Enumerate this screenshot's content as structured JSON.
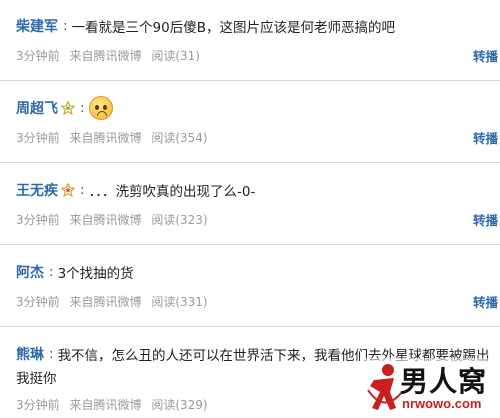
{
  "posts": [
    {
      "author": "柴建军",
      "content": "一看就是三个90后傻B，这图片应该是何老师恶搞的吧",
      "time": "3分钟前",
      "source": "来自腾讯微博",
      "reads": "阅读(31)",
      "forward": "转播"
    },
    {
      "author": "周超飞",
      "content": "",
      "time": "3分钟前",
      "source": "来自腾讯微博",
      "reads": "阅读(354)",
      "forward": "转播",
      "icon": "star-icon",
      "emoji": "crying-face-emoji"
    },
    {
      "author": "王无疾",
      "content": "．．．洗剪吹真的出现了么-0-",
      "time": "3分钟前",
      "source": "来自腾讯微博",
      "reads": "阅读(323)",
      "forward": "转播",
      "icon": "star-icon"
    },
    {
      "author": "阿杰",
      "content": "3个找抽的货",
      "time": "3分钟前",
      "source": "来自腾讯微博",
      "reads": "阅读(331)",
      "forward": "转播"
    },
    {
      "author": "熊琳",
      "content": "我不信，怎么丑的人还可以在世界活下来，我看他们去外星球都要被踢出",
      "content2": "我挺你",
      "time": "3分钟前",
      "source": "来自腾讯微博",
      "reads": "阅读(329)",
      "forward": "转播"
    }
  ],
  "watermark": {
    "title": "男人窝",
    "url": "nrwowo.com"
  },
  "colors": {
    "link": "#2c6aa8",
    "meta": "#9a9a9a",
    "separator": "#d9d9d9",
    "watermark_red": "#c81e1e"
  }
}
